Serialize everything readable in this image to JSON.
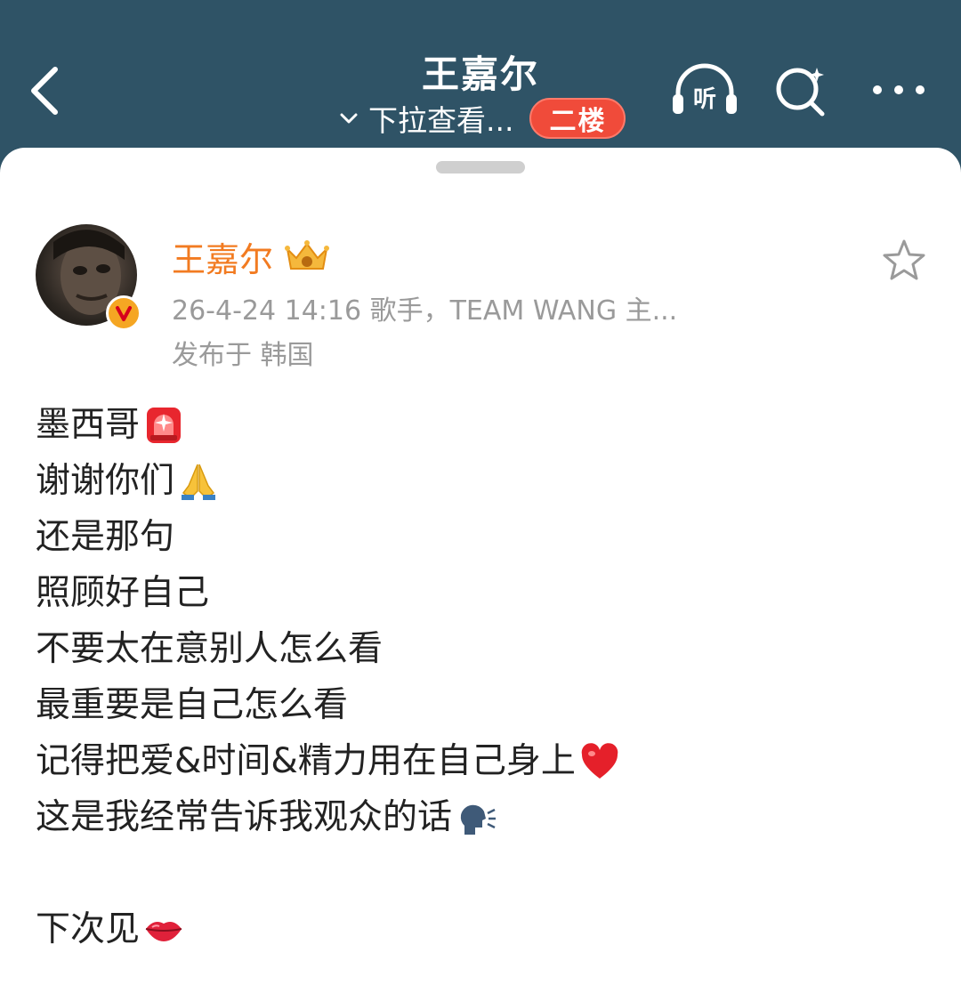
{
  "header": {
    "title": "王嘉尔",
    "subtitle": "下拉查看...",
    "floor_badge": "二楼",
    "listen_label": "听"
  },
  "post": {
    "author_name": "王嘉尔",
    "meta": "26-4-24 14:16  歌手，TEAM WANG 主...",
    "location": "发布于 韩国",
    "lines": [
      {
        "text": "墨西哥",
        "emoji": "siren-emoji"
      },
      {
        "text": "谢谢你们",
        "emoji": "pray-emoji"
      },
      {
        "text": "还是那句",
        "emoji": ""
      },
      {
        "text": "照顾好自己",
        "emoji": ""
      },
      {
        "text": "不要太在意别人怎么看",
        "emoji": ""
      },
      {
        "text": "最重要是自己怎么看",
        "emoji": ""
      },
      {
        "text": "记得把爱&时间&精力用在自己身上",
        "emoji": "red-heart-emoji"
      },
      {
        "text": "这是我经常告诉我观众的话",
        "emoji": "speaking-head-emoji"
      },
      {
        "text": "",
        "emoji": ""
      },
      {
        "text": "下次见",
        "emoji": "kiss-lips-emoji"
      }
    ]
  },
  "colors": {
    "header_bg": "#2f5366",
    "author_name": "#f27b21",
    "badge": "#f04b3a",
    "meta": "#9a9a9a"
  },
  "icons": [
    "back-arrow-icon",
    "chevron-down-icon",
    "headphones-icon",
    "search-icon",
    "more-icon",
    "crown-icon",
    "verified-icon",
    "star-icon"
  ]
}
